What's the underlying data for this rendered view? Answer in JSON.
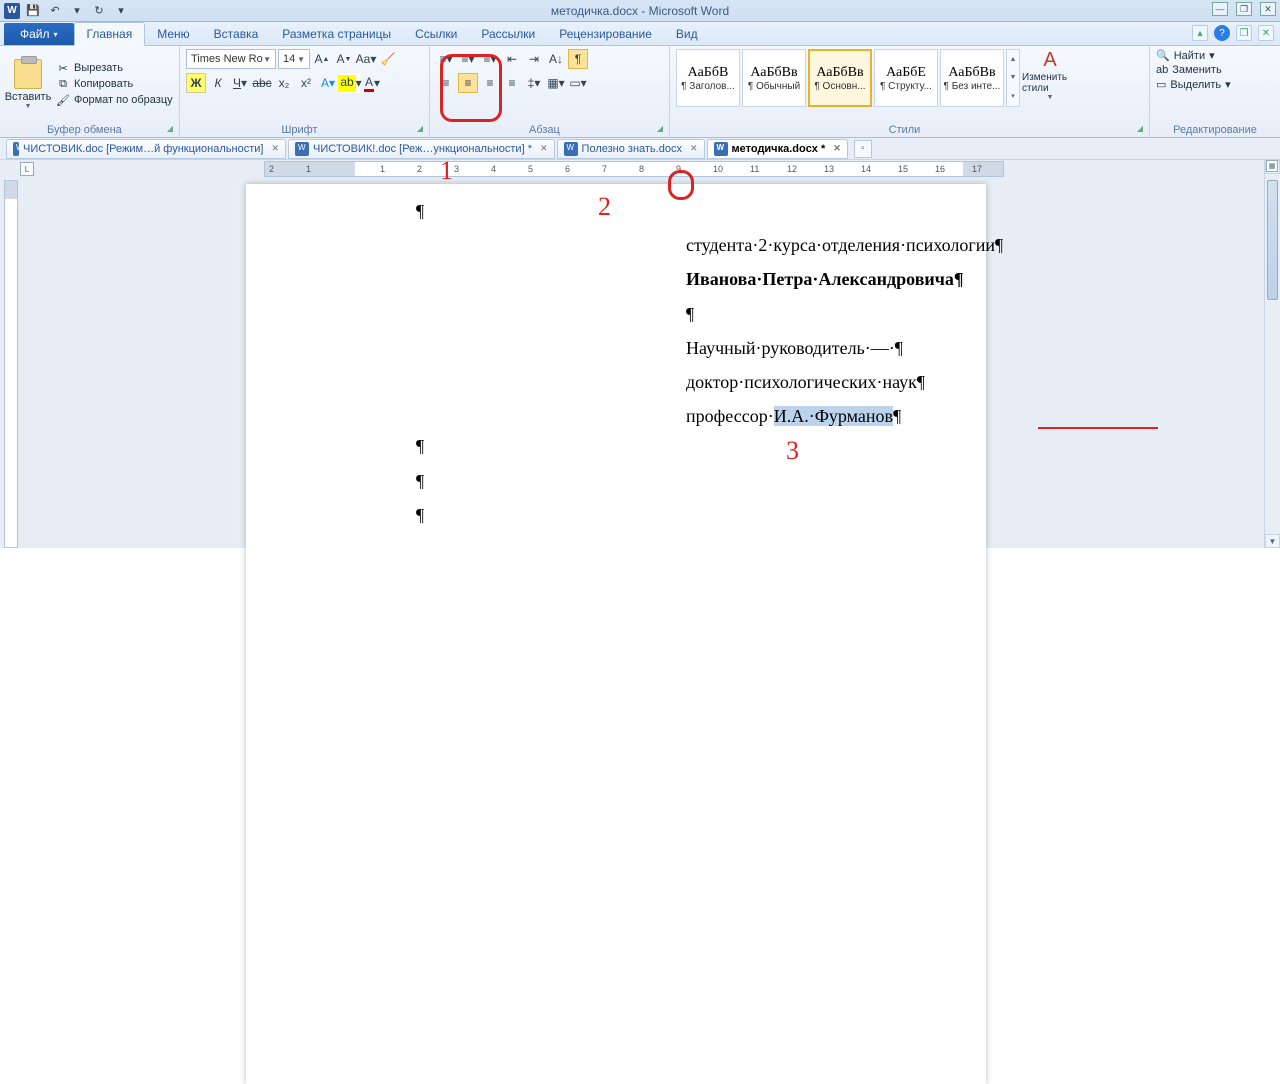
{
  "window": {
    "title": "методичка.docx - Microsoft Word",
    "qat": {
      "save": "💾",
      "undo": "↶",
      "redo": "↻"
    }
  },
  "tabs": {
    "file": "Файл",
    "items": [
      "Главная",
      "Меню",
      "Вставка",
      "Разметка страницы",
      "Ссылки",
      "Рассылки",
      "Рецензирование",
      "Вид"
    ],
    "active": "Главная"
  },
  "ribbon": {
    "clipboard": {
      "label": "Буфер обмена",
      "paste": "Вставить",
      "cut": "Вырезать",
      "copy": "Копировать",
      "format_painter": "Формат по образцу"
    },
    "font": {
      "label": "Шрифт",
      "face": "Times New Ro",
      "size": "14"
    },
    "paragraph": {
      "label": "Абзац"
    },
    "styles": {
      "label": "Стили",
      "items": [
        {
          "preview": "АаБбВ",
          "name": "¶ Заголов..."
        },
        {
          "preview": "АаБбВв",
          "name": "¶ Обычный"
        },
        {
          "preview": "АаБбВв",
          "name": "¶ Основн...",
          "selected": true
        },
        {
          "preview": "АаБбЕ",
          "name": "¶ Структу..."
        },
        {
          "preview": "АаБбВв",
          "name": "¶ Без инте..."
        }
      ],
      "change": "Изменить стили"
    },
    "editing": {
      "label": "Редактирование",
      "find": "Найти",
      "replace": "Заменить",
      "select": "Выделить"
    }
  },
  "doc_tabs": [
    {
      "name": "ЧИСТОВИК.doc [Режим…й функциональности]",
      "active": false
    },
    {
      "name": "ЧИСТОВИК!.doc [Реж…ункциональности] *",
      "active": false
    },
    {
      "name": "Полезно знать.docx",
      "active": false
    },
    {
      "name": "методичка.docx *",
      "active": true
    }
  ],
  "document": {
    "lines": [
      {
        "text": "¶",
        "cls": ""
      },
      {
        "text": "студента·2·курса·отделения·психологии¶",
        "cls": "right-block"
      },
      {
        "text_bold": "Иванова·Петра·Александровича¶",
        "cls": "right-block"
      },
      {
        "text": "¶",
        "cls": "right-block"
      },
      {
        "text": "Научный·руководитель·—·¶",
        "cls": "right-block"
      },
      {
        "text": "доктор·психологических·наук¶",
        "cls": "right-block"
      },
      {
        "prefix": "профессор·",
        "sel": "И.А.·Фурманов",
        "suffix": "¶",
        "cls": "right-block",
        "underline": true
      },
      {
        "text": "¶",
        "cls": ""
      },
      {
        "text": "¶",
        "cls": ""
      },
      {
        "text": "¶",
        "cls": ""
      }
    ]
  },
  "annotations": {
    "n1": "1",
    "n2": "2",
    "n3": "3"
  },
  "ruler": {
    "nums": [
      "2",
      "1",
      "",
      "1",
      "2",
      "3",
      "4",
      "5",
      "6",
      "7",
      "8",
      "9",
      "10",
      "11",
      "12",
      "13",
      "14",
      "15",
      "16",
      "17"
    ]
  }
}
